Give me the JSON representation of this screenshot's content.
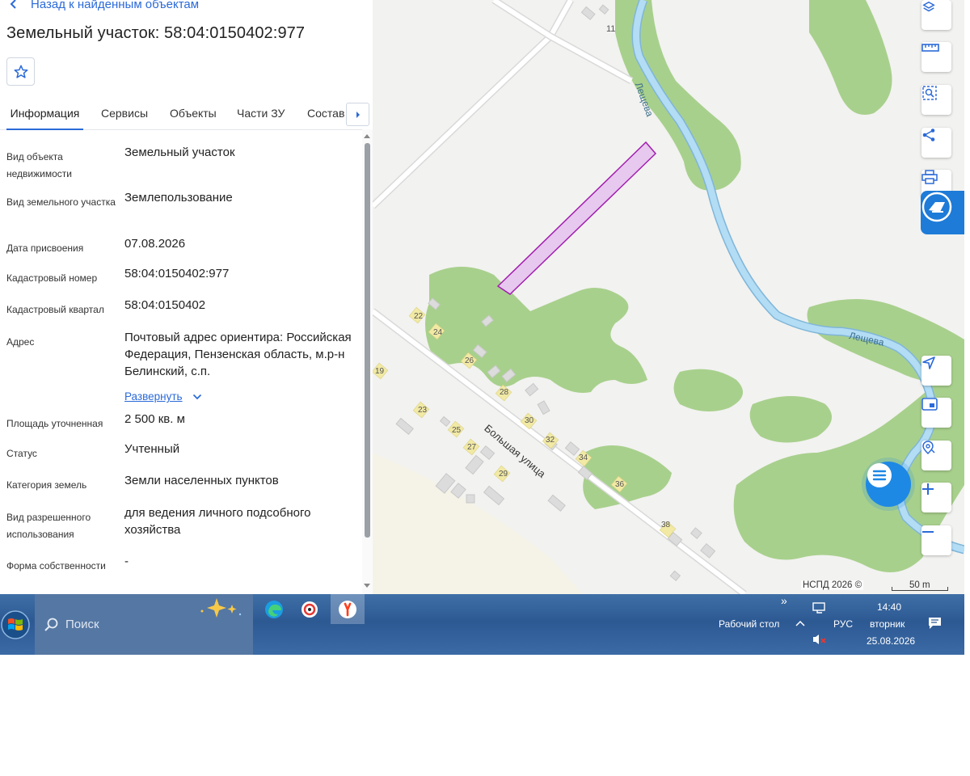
{
  "panel": {
    "back_label": "Назад к найденным объектам",
    "title": "Земельный участок: 58:04:0150402:977",
    "tabs": [
      "Информация",
      "Сервисы",
      "Объекты",
      "Части ЗУ",
      "Состав"
    ],
    "rows": [
      {
        "label": "Вид объекта недвижимости",
        "value": "Земельный участок"
      },
      {
        "label": "Вид земельного участка",
        "value": "Землепользование"
      },
      {
        "label": "Дата присвоения",
        "value": "07.08.2026"
      },
      {
        "label": "Кадастровый номер",
        "value": "58:04:0150402:977"
      },
      {
        "label": "Кадастровый квартал",
        "value": "58:04:0150402"
      },
      {
        "label": "Адрес",
        "value": "Почтовый адрес ориентира: Российская Федерация, Пензенская область, м.р-н Белинский, с.п."
      },
      {
        "label": "Площадь уточненная",
        "value": "2 500 кв. м"
      },
      {
        "label": "Статус",
        "value": "Учтенный"
      },
      {
        "label": "Категория земель",
        "value": "Земли населенных пунктов"
      },
      {
        "label": "Вид разрешенного использования",
        "value": "для ведения личного подсобного хозяйства"
      },
      {
        "label": "Форма собственности",
        "value": "-"
      }
    ],
    "expand_label": "Развернуть"
  },
  "map": {
    "river_name": "Лещева",
    "street_name": "Большая улица",
    "house_numbers": [
      "11",
      "22",
      "24",
      "26",
      "19",
      "28",
      "23",
      "30",
      "25",
      "32",
      "27",
      "34",
      "29",
      "36",
      "38"
    ],
    "copyright": "НСПД 2026 ©",
    "scale": "50 m",
    "colors": {
      "forest": "#a8d08d",
      "river": "#b3dcf5",
      "parcel_fill": "#e7c8ee",
      "parcel_stroke": "#a21eb0",
      "accent": "#1e7bd8"
    },
    "controls": [
      "layers-icon",
      "ruler-icon",
      "area-select-icon",
      "share-icon",
      "print-icon",
      "locate-icon",
      "minimap-icon",
      "search-location-icon",
      "zoom-in-icon",
      "zoom-out-icon"
    ]
  },
  "taskbar": {
    "search_placeholder": "Поиск",
    "desktop_label": "Рабочий стол",
    "language": "РУС",
    "time": "14:40",
    "weekday": "вторник",
    "date": "25.08.2026"
  }
}
